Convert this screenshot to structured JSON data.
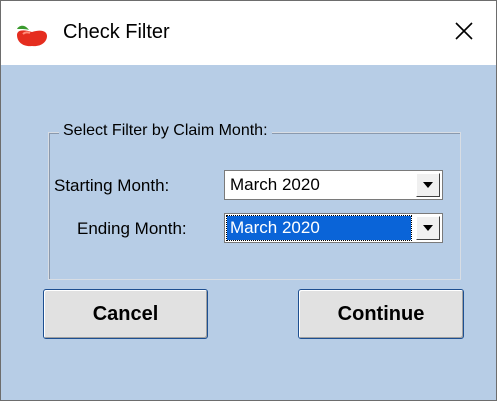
{
  "window": {
    "title": "Check Filter",
    "app_icon": "apple-icon",
    "close_icon": "close-icon"
  },
  "filter_group": {
    "legend": "Select Filter by Claim Month:",
    "starting_month": {
      "label": "Starting Month:",
      "value": "March 2020"
    },
    "ending_month": {
      "label": "Ending Month:",
      "value": "March 2020"
    }
  },
  "buttons": {
    "cancel_label": "Cancel",
    "continue_label": "Continue"
  },
  "colors": {
    "client_background": "#b7cde6",
    "selection_highlight": "#0a64d8",
    "button_border": "#1d4f91"
  }
}
